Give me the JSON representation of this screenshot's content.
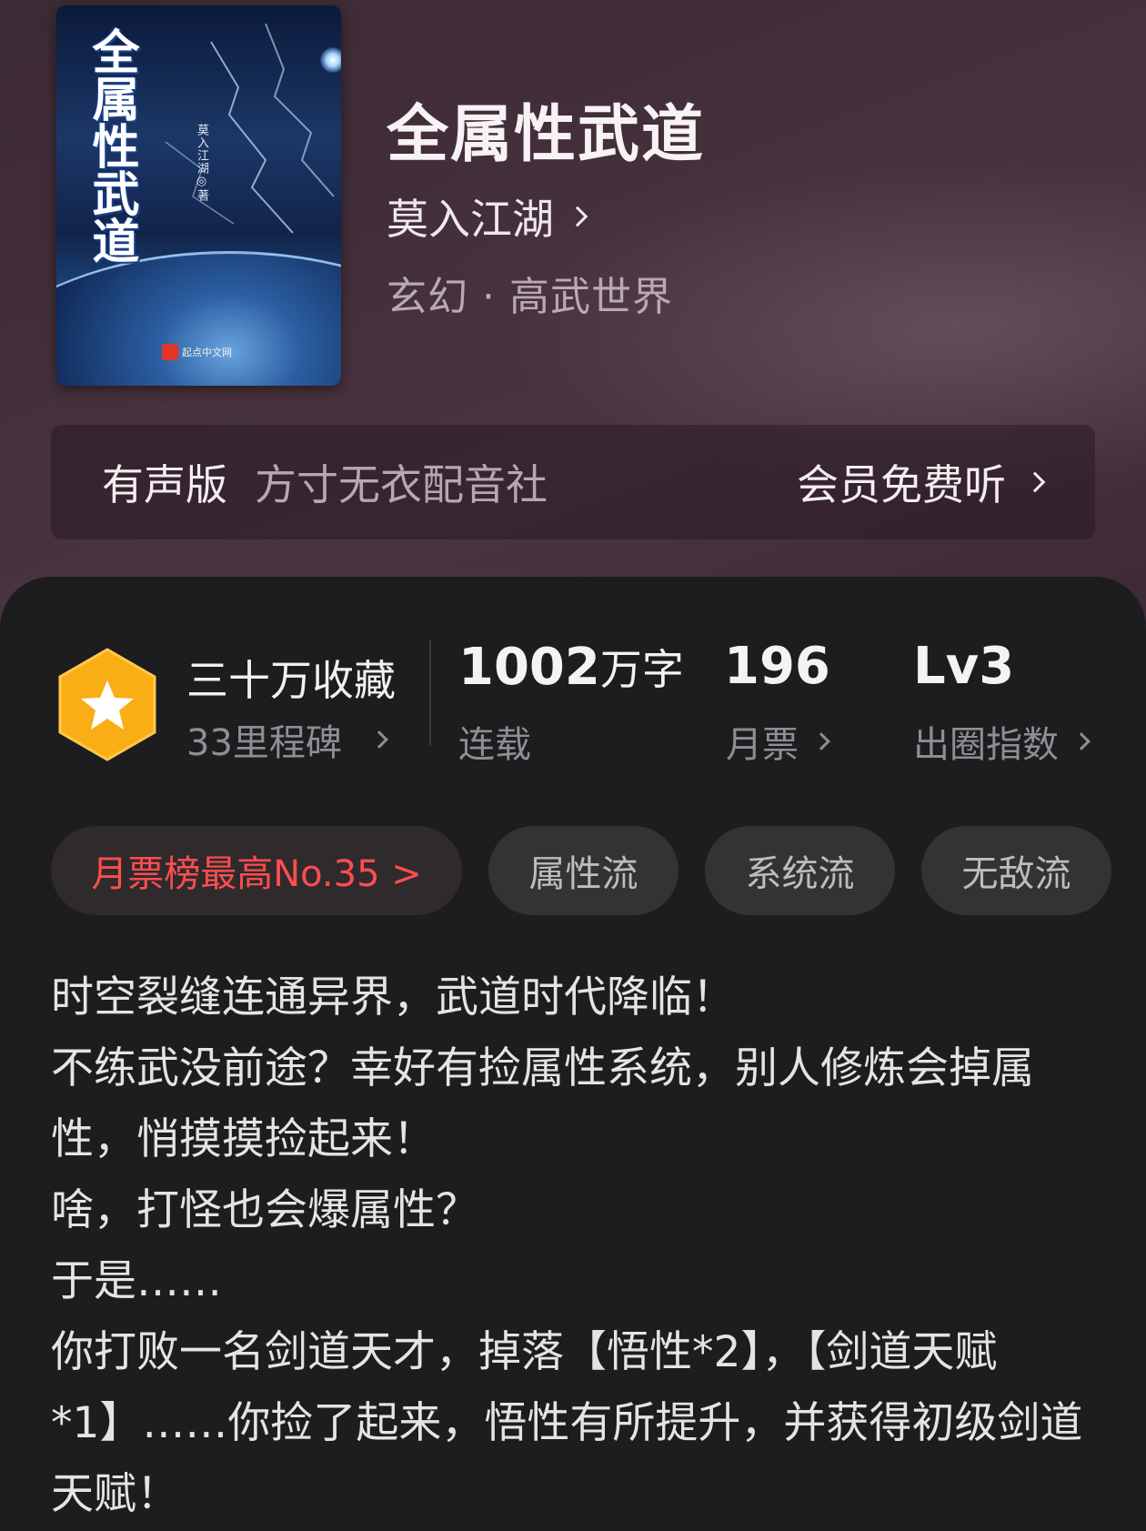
{
  "cover": {
    "title": "全属性武道",
    "author_tag": "莫入江湖◎著",
    "brand": "起点中文网"
  },
  "book": {
    "title": "全属性武道",
    "author": "莫入江湖",
    "genre": "玄幻 · 高武世界"
  },
  "audio": {
    "label": "有声版",
    "studio": "方寸无衣配音社",
    "listen": "会员免费听"
  },
  "stats": {
    "favorites": "三十万收藏",
    "milestone": "33里程碑",
    "words_value": "1002",
    "words_unit": "万字",
    "words_label": "连载",
    "tickets_value": "196",
    "tickets_label": "月票",
    "level_value": "Lv3",
    "level_label": "出圈指数"
  },
  "tags": {
    "rank": "月票榜最高No.35 >",
    "items": [
      "属性流",
      "系统流",
      "无敌流"
    ]
  },
  "description": [
    "时空裂缝连通异界，武道时代降临！",
    "不练武没前途？幸好有捡属性系统，别人修炼会掉属性，悄摸摸捡起来！",
    "啥，打怪也会爆属性？",
    "于是……",
    "你打败一名剑道天才，掉落【悟性*2】，【剑道天赋*1】……你捡了起来，悟性有所提升，并获得初级剑道天赋！"
  ],
  "colors": {
    "accent_red": "#ff4d4f",
    "badge_orange": "#f9ae16",
    "panel_bg": "#1d1d1f"
  }
}
